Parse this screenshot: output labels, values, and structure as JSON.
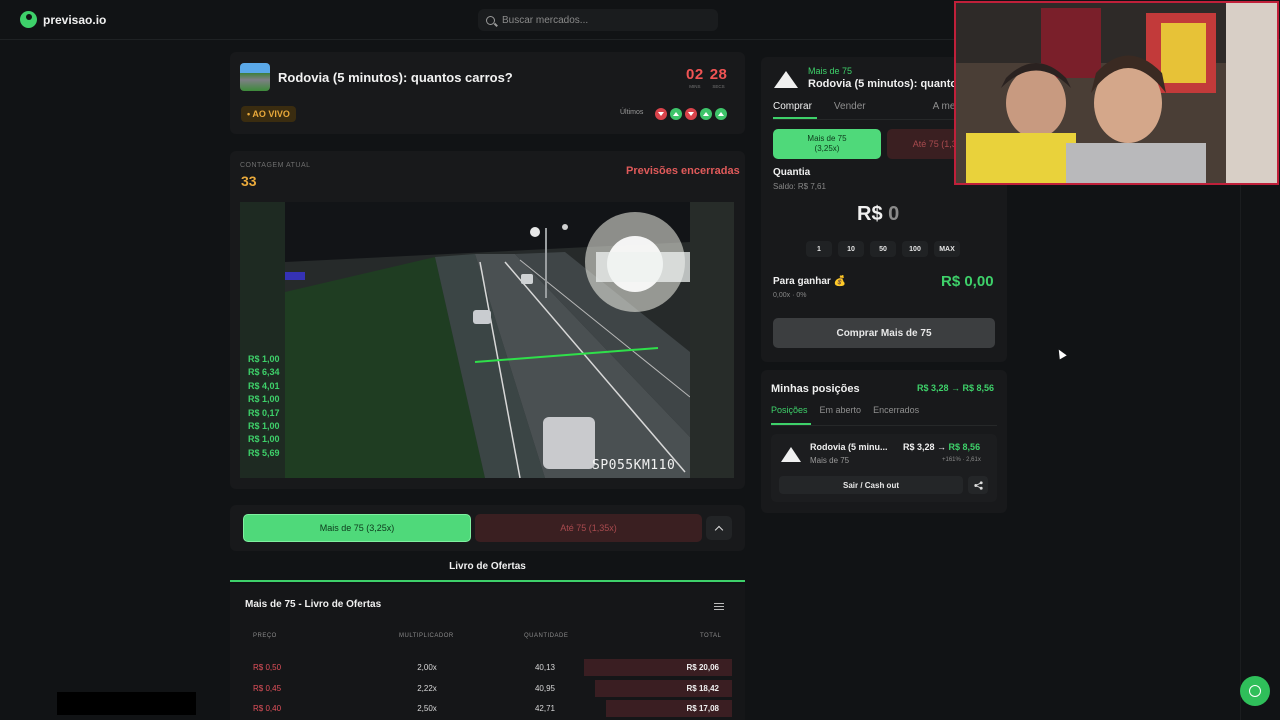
{
  "app": {
    "logo_text": "previsao.io",
    "accent": "#3ed16a"
  },
  "search": {
    "placeholder": "Buscar mercados..."
  },
  "market": {
    "title": "Rodovia (5 minutos): quantos carros?",
    "timer": {
      "minutes": "02",
      "seconds": "28",
      "minutes_label": "MINS",
      "seconds_label": "SECS"
    },
    "live_label": "• AO VIVO",
    "last_label": "Últimos",
    "last_results": [
      "down",
      "up",
      "down",
      "up",
      "up"
    ]
  },
  "stream": {
    "count_label": "CONTAGEM ATUAL",
    "count_value": "33",
    "status": "Previsões encerradas",
    "camera_id": "SP055KM110",
    "recent_trades": [
      "R$ 1,00",
      "R$ 6,34",
      "R$ 4,01",
      "R$ 1,00",
      "R$ 0,17",
      "R$ 1,00",
      "R$ 1,00",
      "R$ 5,69"
    ]
  },
  "outcomes": {
    "more_label": "Mais de 75 (3,25x)",
    "until_label": "Até 75 (1,35x)"
  },
  "order_book": {
    "tab_label": "Livro de Ofertas",
    "title": "Mais de 75 - Livro de Ofertas",
    "columns": {
      "price": "PREÇO",
      "multiplier": "MULTIPLICADOR",
      "quantity": "QUANTIDADE",
      "total": "TOTAL"
    },
    "rows": [
      {
        "price": "R$ 0,50",
        "multiplier": "2,00x",
        "quantity": "40,13",
        "total": "R$ 20,06",
        "depth": 0.82
      },
      {
        "price": "R$ 0,45",
        "multiplier": "2,22x",
        "quantity": "40,95",
        "total": "R$ 18,42",
        "depth": 0.76
      },
      {
        "price": "R$ 0,40",
        "multiplier": "2,50x",
        "quantity": "42,71",
        "total": "R$ 17,08",
        "depth": 0.7
      }
    ]
  },
  "trade_panel": {
    "outcome": "Mais de 75",
    "title": "Rodovia (5 minutos): quantos carros?",
    "tabs": [
      "Comprar",
      "Vender",
      "A mercado"
    ],
    "more_line1": "Mais de 75",
    "more_line2": "(3,25x)",
    "until_label": "Até 75 (1,35x)",
    "quantity_label": "Quantia",
    "balance": "Saldo: R$ 7,61",
    "amount_currency": "R$",
    "amount_value": "0",
    "chips": [
      "1",
      "10",
      "50",
      "100",
      "MAX"
    ],
    "gain_label": "Para ganhar 💰",
    "gain_sub": "0,00x · 0%",
    "gain_value": "R$ 0,00",
    "buy_button": "Comprar Mais de 75"
  },
  "positions": {
    "title": "Minhas posições",
    "pnl": "R$ 3,28 → R$ 8,56",
    "tabs": [
      "Posições",
      "Em aberto",
      "Encerrados"
    ],
    "item": {
      "name": "Rodovia (5 minu...",
      "outcome": "Mais de 75",
      "value_from": "R$ 3,28 →",
      "value_to": "R$ 8,56",
      "change": "+161% · 2,61x",
      "cashout": "Sair / Cash out"
    }
  }
}
